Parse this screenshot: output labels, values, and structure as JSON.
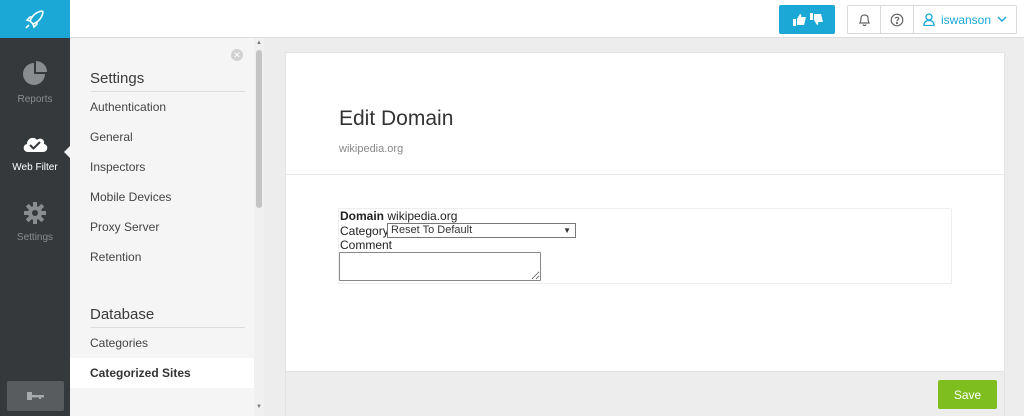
{
  "topbar": {
    "user_name": "iswanson"
  },
  "leftnav": {
    "items": [
      {
        "label": "Reports",
        "icon": "pie-chart-icon"
      },
      {
        "label": "Web Filter",
        "icon": "cloud-check-icon"
      },
      {
        "label": "Settings",
        "icon": "gear-icon"
      }
    ]
  },
  "sidebar": {
    "settings_heading": "Settings",
    "settings_items": [
      "Authentication",
      "General",
      "Inspectors",
      "Mobile Devices",
      "Proxy Server",
      "Retention"
    ],
    "database_heading": "Database",
    "database_items": [
      "Categories",
      "Categorized Sites"
    ]
  },
  "main": {
    "title": "Edit Domain",
    "subtitle": "wikipedia.org",
    "form": {
      "domain_label": "Domain",
      "domain_value": "wikipedia.org",
      "category_label": "Category",
      "category_value": "Reset To Default",
      "comment_label": "Comment",
      "comment_value": ""
    },
    "save_label": "Save"
  },
  "colors": {
    "brand": "#1ba8d6",
    "nav_bg": "#35393c",
    "save": "#7fbe1f"
  }
}
